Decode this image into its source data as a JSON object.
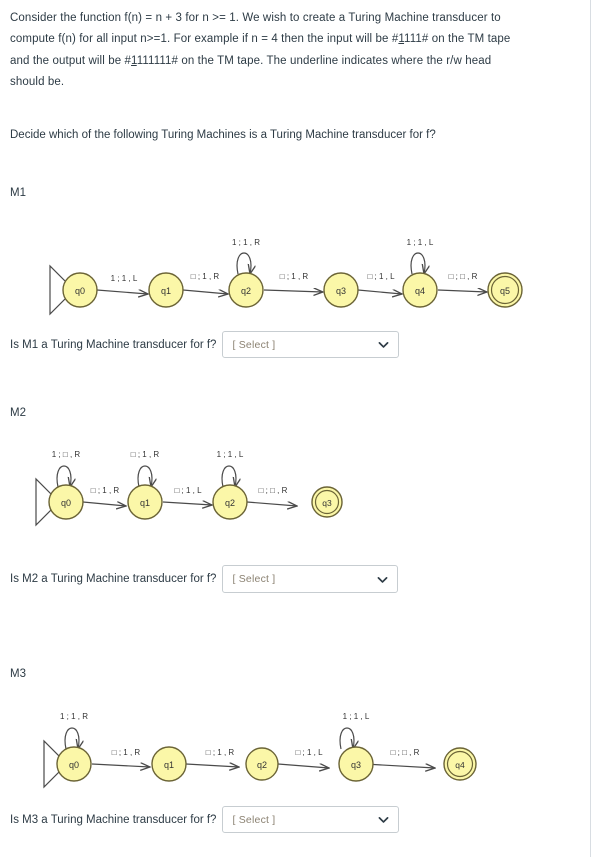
{
  "intro": {
    "line1_a": "Consider the function f(n) = n + 3 for n >= 1.  We wish to create a Turing Machine transducer to",
    "line2_a": "compute f(n)  for all input n>=1. For example if n = 4 then the  input will be #",
    "line2_u": "1",
    "line2_b": "111#  on the TM tape",
    "line3_a": "and the output will be #",
    "line3_u": "1",
    "line3_b": "111111# on the TM tape. The underline indicates where the r/w head",
    "line4": "should be."
  },
  "prompt": "Decide which of the following Turing Machines is a Turing Machine transducer for f?",
  "colors": {
    "state_fill": "#fbf7a8",
    "state_stroke": "#6b6436",
    "edge": "#4a4a4a",
    "text": "#2d3b45",
    "select_placeholder": "#8b8272"
  },
  "machines": [
    {
      "id": "M1",
      "label": "M1",
      "states": [
        "q0",
        "q1",
        "q2",
        "q3",
        "q4",
        "q5"
      ],
      "accepting": "q5",
      "start": "q0",
      "transitions": [
        {
          "from": "q0",
          "to": "q1",
          "label": "1 ; 1 , L"
        },
        {
          "from": "q1",
          "to": "q2",
          "label": "□ ; 1 , R"
        },
        {
          "from": "q2",
          "to": "q3",
          "label": "□ ; 1 , R"
        },
        {
          "from": "q3",
          "to": "q4",
          "label": "□ ; 1 , L"
        },
        {
          "from": "q4",
          "to": "q5",
          "label": "□ ; □ , R"
        }
      ],
      "self_loops": [
        {
          "state": "q2",
          "label": "1 ; 1 , R"
        },
        {
          "state": "q4",
          "label": "1 ; 1 , L"
        }
      ],
      "question": "Is M1 a Turing Machine transducer for f?",
      "select_value": "[ Select ]"
    },
    {
      "id": "M2",
      "label": "M2",
      "states": [
        "q0",
        "q1",
        "q2",
        "q3"
      ],
      "accepting": "q3",
      "start": "q0",
      "transitions": [
        {
          "from": "q0",
          "to": "q1",
          "label": "□ ; 1 , R"
        },
        {
          "from": "q1",
          "to": "q2",
          "label": "□ ; 1 , L"
        },
        {
          "from": "q2",
          "to": "q3",
          "label": "□ ; □ , R"
        }
      ],
      "self_loops": [
        {
          "state": "q0",
          "label": "1 ; □ , R"
        },
        {
          "state": "q1",
          "label": "□ ; 1 , R"
        },
        {
          "state": "q2",
          "label": "1 ; 1 , L"
        }
      ],
      "question": "Is M2 a Turing Machine transducer for f?",
      "select_value": "[ Select ]"
    },
    {
      "id": "M3",
      "label": "M3",
      "states": [
        "q0",
        "q1",
        "q2",
        "q3",
        "q4"
      ],
      "accepting": "q4",
      "start": "q0",
      "transitions": [
        {
          "from": "q0",
          "to": "q1",
          "label": "□ ; 1 , R"
        },
        {
          "from": "q1",
          "to": "q2",
          "label": "□ ; 1 , R"
        },
        {
          "from": "q2",
          "to": "q3",
          "label": "□ ; 1 , L"
        },
        {
          "from": "q3",
          "to": "q4",
          "label": "□ ; □ , R"
        }
      ],
      "self_loops": [
        {
          "state": "q0",
          "label": "1 ; 1 , R"
        },
        {
          "state": "q3",
          "label": "1 ; 1 , L"
        }
      ],
      "question": "Is M3 a Turing Machine transducer for f?",
      "select_value": "[ Select ]"
    }
  ]
}
